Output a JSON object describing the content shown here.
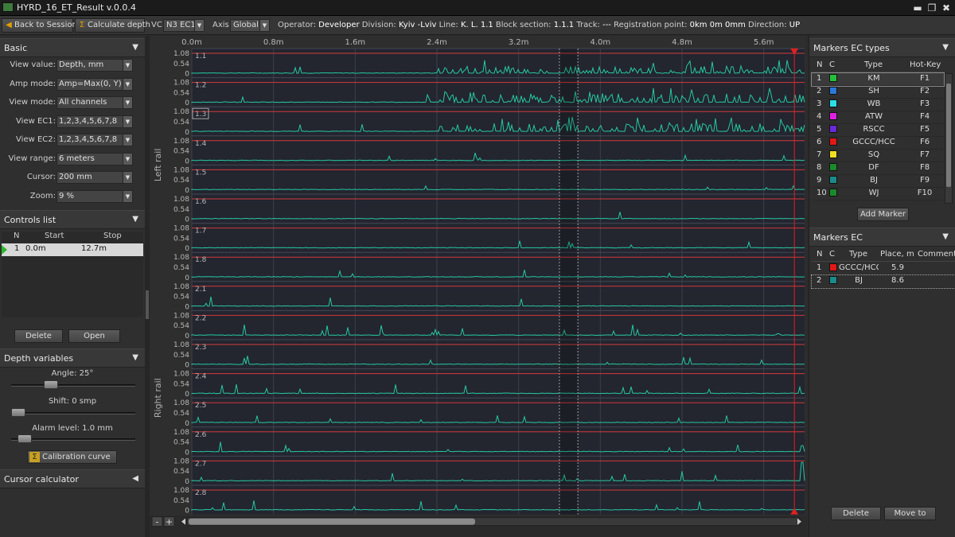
{
  "window": {
    "title": "HYRD_16_ET_Result v.0.0.4"
  },
  "toolbar": {
    "back_label": "Back to Sessions",
    "calc_label": "Calculate depth",
    "vc_label": "VC:",
    "vc_value": "N3 EC1",
    "axis_label": "Axis:",
    "axis_value": "Global",
    "operator_label": "Operator:",
    "operator_value": "Developer",
    "division_label": "Division:",
    "division_value": "Kyiv -Lviv",
    "line_label": "Line:",
    "line_value": "K. L. 1.1",
    "block_label": "Block section:",
    "block_value": "1.1.1",
    "track_label": "Track:",
    "track_value": "---",
    "reg_label": "Registration point:",
    "reg_value": "0km 0m 0mm",
    "direction_label": "Direction:",
    "direction_value": "UP"
  },
  "basic": {
    "title": "Basic",
    "fields": [
      {
        "label": "View value:",
        "value": "Depth, mm"
      },
      {
        "label": "Amp mode:",
        "value": "Amp=Max(0, Y)"
      },
      {
        "label": "View mode:",
        "value": "All channels"
      },
      {
        "label": "View EC1:",
        "value": "1,2,3,4,5,6,7,8"
      },
      {
        "label": "View EC2:",
        "value": "1,2,3,4,5,6,7,8"
      },
      {
        "label": "View range:",
        "value": "6 meters"
      },
      {
        "label": "Cursor:",
        "value": "200 mm"
      },
      {
        "label": "Zoom:",
        "value": "9 %"
      }
    ]
  },
  "controls": {
    "title": "Controls list",
    "headers": [
      "N",
      "Start",
      "Stop"
    ],
    "rows": [
      {
        "n": "1",
        "start": "0.0m",
        "stop": "12.7m"
      }
    ],
    "delete_label": "Delete",
    "open_label": "Open"
  },
  "depth": {
    "title": "Depth variables",
    "angle_label": "Angle: 25°",
    "angle_level": 0.3,
    "shift_label": "Shift: 0 smp",
    "shift_level": 0.0,
    "alarm_label": "Alarm level: 1.0 mm",
    "alarm_level": 0.06,
    "calib_label": "Calibration curve"
  },
  "cursor_calc": {
    "title": "Cursor calculator"
  },
  "plot": {
    "x_ticks": [
      "0.0m",
      "0.8m",
      "1.6m",
      "2.4m",
      "3.2m",
      "4.0m",
      "4.8m",
      "5.6m"
    ],
    "x_tick_values": [
      0.0,
      0.8,
      1.6,
      2.4,
      3.2,
      4.0,
      4.8,
      5.6
    ],
    "x_range": [
      0.0,
      6.0
    ],
    "y_ticks": [
      "1.08",
      "0.54",
      "0"
    ],
    "left_rail_label": "Left rail",
    "right_rail_label": "Right rail",
    "channels": [
      "1.1",
      "1.2",
      "1.3",
      "1.4",
      "1.5",
      "1.6",
      "1.7",
      "1.8",
      "2.1",
      "2.2",
      "2.3",
      "2.4",
      "2.5",
      "2.6",
      "2.7",
      "2.8"
    ],
    "cursor_x": 5.9,
    "dotted_x": [
      3.6,
      3.78
    ],
    "trace_color": "#26c8a0",
    "threshold_color": "#d23a3a",
    "cursor_color": "#e02020",
    "zoom_minus": "-",
    "zoom_plus": "+"
  },
  "marker_types": {
    "title": "Markers EC types",
    "headers": [
      "N",
      "C",
      "Type",
      "Hot-Key"
    ],
    "rows": [
      {
        "n": "1",
        "color": "#22c03a",
        "type": "KM",
        "key": "F1"
      },
      {
        "n": "2",
        "color": "#2a78d8",
        "type": "SH",
        "key": "F2"
      },
      {
        "n": "3",
        "color": "#2ae0e8",
        "type": "WB",
        "key": "F3"
      },
      {
        "n": "4",
        "color": "#e020e0",
        "type": "ATW",
        "key": "F4"
      },
      {
        "n": "5",
        "color": "#6a2ad8",
        "type": "RSCC",
        "key": "F5"
      },
      {
        "n": "6",
        "color": "#e01818",
        "type": "GCCC/HCC",
        "key": "F6"
      },
      {
        "n": "7",
        "color": "#f0e020",
        "type": "SQ",
        "key": "F7"
      },
      {
        "n": "8",
        "color": "#1a8a2a",
        "type": "DF",
        "key": "F8"
      },
      {
        "n": "9",
        "color": "#1a8a8a",
        "type": "BJ",
        "key": "F9"
      },
      {
        "n": "10",
        "color": "#1a8a2a",
        "type": "WJ",
        "key": "F10"
      }
    ],
    "add_label": "Add Marker"
  },
  "markers_ec": {
    "title": "Markers EC",
    "headers": [
      "N",
      "C",
      "Type",
      "Place, m",
      "Comment"
    ],
    "rows": [
      {
        "n": "1",
        "color": "#e01818",
        "type": "GCCC/HCC",
        "place": "5.9",
        "comment": ""
      },
      {
        "n": "2",
        "color": "#1a8a8a",
        "type": "BJ",
        "place": "8.6",
        "comment": ""
      }
    ],
    "delete_label": "Delete",
    "move_label": "Move to"
  }
}
